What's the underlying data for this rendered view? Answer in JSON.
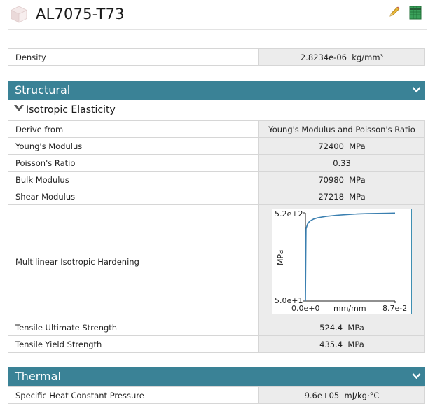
{
  "header": {
    "title": "AL7075-T73",
    "material_icon": "cube-icon",
    "edit_icon": "pencil-icon",
    "table_icon": "data-table-icon"
  },
  "general": {
    "rows": [
      {
        "label": "Density",
        "value": "2.8234e-06",
        "unit": "kg/mm³"
      }
    ]
  },
  "structural": {
    "title": "Structural",
    "subsection": "Isotropic Elasticity",
    "rows": [
      {
        "label": "Derive from",
        "value": "Young's Modulus and Poisson's Ratio",
        "unit": ""
      },
      {
        "label": "Young's Modulus",
        "value": "72400",
        "unit": "MPa"
      },
      {
        "label": "Poisson's Ratio",
        "value": "0.33",
        "unit": ""
      },
      {
        "label": "Bulk Modulus",
        "value": "70980",
        "unit": "MPa"
      },
      {
        "label": "Shear Modulus",
        "value": "27218",
        "unit": "MPa"
      }
    ],
    "hardening_label": "Multilinear Isotropic Hardening",
    "rows_after": [
      {
        "label": "Tensile Ultimate Strength",
        "value": "524.4",
        "unit": "MPa"
      },
      {
        "label": "Tensile Yield Strength",
        "value": "435.4",
        "unit": "MPa"
      }
    ]
  },
  "thermal": {
    "title": "Thermal",
    "rows": [
      {
        "label": "Specific Heat Constant Pressure",
        "value": "9.6e+05",
        "unit": "mJ/kg·°C"
      }
    ]
  },
  "chart_data": {
    "type": "line",
    "title": "",
    "xlabel": "mm/mm",
    "ylabel": "MPa",
    "xlim": [
      0,
      0.087
    ],
    "ylim": [
      50,
      520
    ],
    "x_tick_labels": [
      "0.0e+0",
      "8.7e-2"
    ],
    "y_tick_labels": [
      "5.0e+1",
      "5.2e+2"
    ],
    "grid": false,
    "line_color": "#3a7fb0",
    "series": [
      {
        "x": [
          0,
          0.0006,
          0.002,
          0.004,
          0.008,
          0.012,
          0.02,
          0.03,
          0.04,
          0.05,
          0.06,
          0.07,
          0.08,
          0.087
        ],
        "y": [
          50,
          435,
          460,
          475,
          487,
          494,
          501,
          507,
          511,
          514,
          516,
          517,
          518,
          519
        ]
      }
    ]
  }
}
